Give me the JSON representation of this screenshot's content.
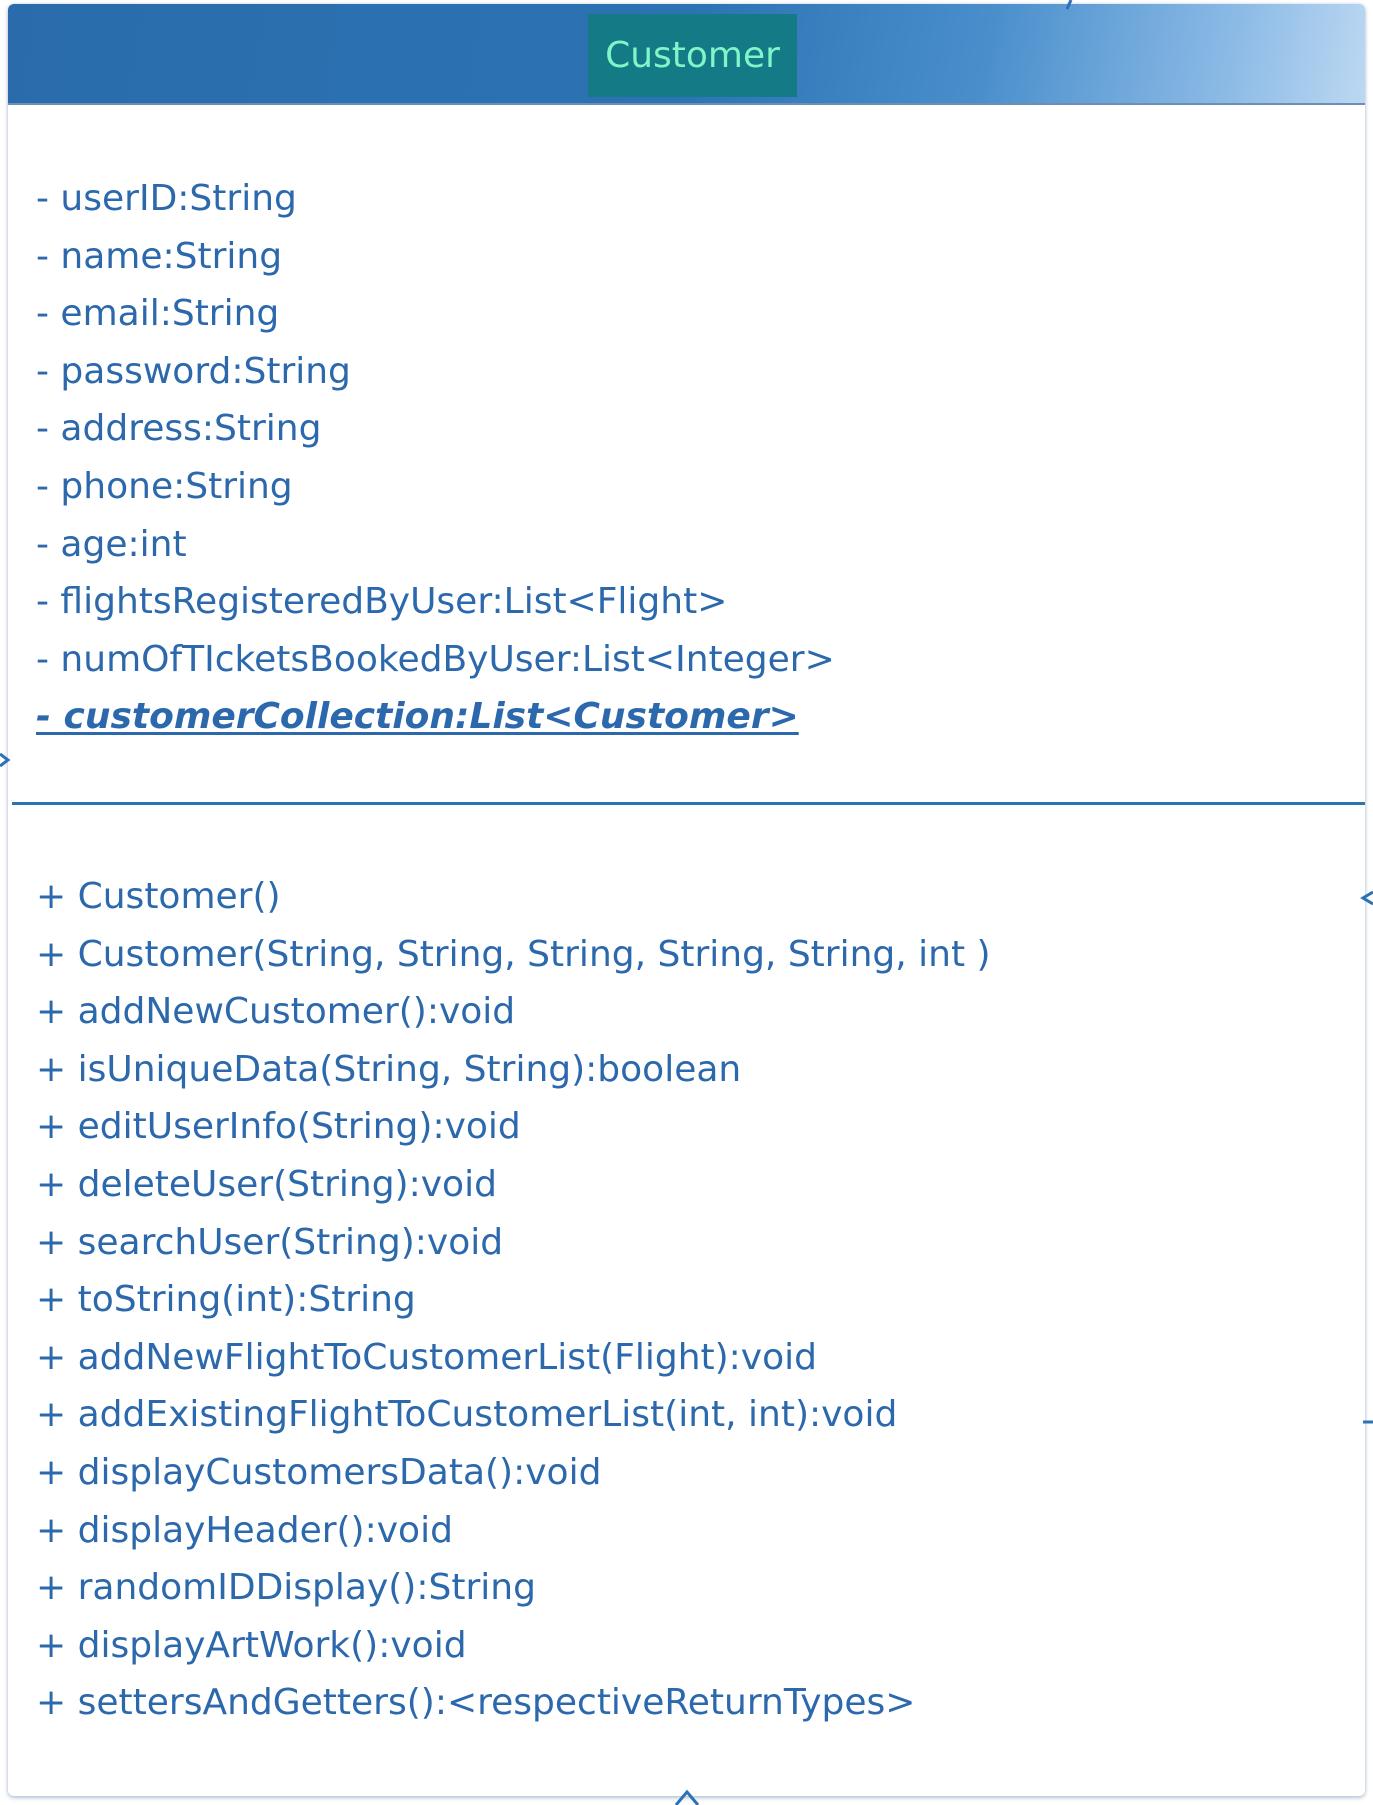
{
  "class_box": {
    "name": "Customer",
    "colors": {
      "header": "#2c73b4",
      "name_background": "#137a86",
      "name_text": "#7ff5c8",
      "member_text": "#2c68ac",
      "divider": "#2d72b4"
    },
    "attributes": [
      "- userID:String",
      "- name:String",
      "- email:String",
      "- password:String",
      "- address:String",
      "- phone:String",
      "- age:int",
      "- flightsRegisteredByUser:List<Flight>",
      "- numOfTIcketsBookedByUser:List<Integer>",
      "- customerCollection:List<Customer>"
    ],
    "static_attribute_index": 9,
    "operations": [
      "+ Customer()",
      "+ Customer(String, String, String, String, String, int )",
      "+ addNewCustomer():void",
      "+ isUniqueData(String, String):boolean",
      "+ editUserInfo(String):void",
      "+ deleteUser(String):void",
      "+ searchUser(String):void",
      "+ toString(int):String",
      "+ addNewFlightToCustomerList(Flight):void",
      "+ addExistingFlightToCustomerList(int, int):void",
      "+ displayCustomersData():void",
      "+ displayHeader():void",
      "+ randomIDDisplay():String",
      "+ displayArtWork():void",
      "+ settersAndGetters():<respectiveReturnTypes>"
    ]
  }
}
